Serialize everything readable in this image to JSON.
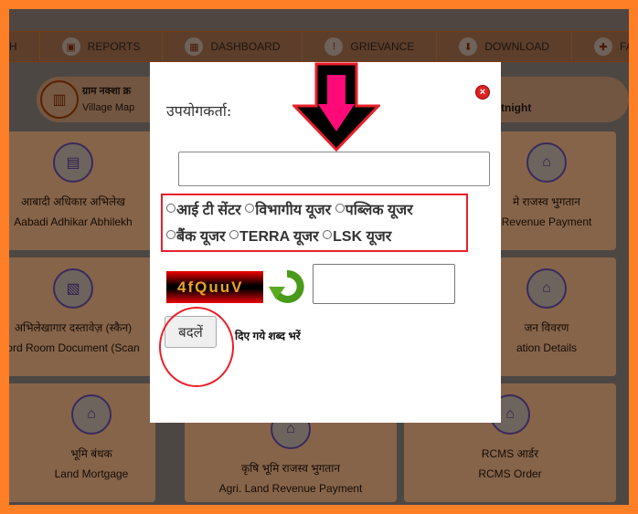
{
  "nav": {
    "items": [
      {
        "label": "H",
        "icon": "search-icon"
      },
      {
        "label": "REPORTS",
        "icon": "report-icon"
      },
      {
        "label": "DASHBOARD",
        "icon": "dashboard-icon"
      },
      {
        "label": "GRIEVANCE",
        "icon": "grievance-icon"
      },
      {
        "label": "DOWNLOAD",
        "icon": "download-icon"
      },
      {
        "label": "FAQ",
        "icon": "faq-icon"
      }
    ]
  },
  "banner": {
    "hindi": "ग्राम नक्शा क्र",
    "english": "Village Map",
    "right": "ortnight"
  },
  "cards": [
    {
      "hi": "आबादी अधिकार अभिलेख",
      "en": "Aabadi Adhikar Abhilekh"
    },
    {
      "hi": "मे राजस्व भुगतान",
      "en": "Revenue Payment"
    },
    {
      "hi": "अभिलेखागार दस्तावेज़ (स्कैन)",
      "en": "ord Room Document (Scan"
    },
    {
      "hi": "जन विवरण",
      "en": "ation Details"
    },
    {
      "hi": "भूमि बंधक",
      "en": "Land Mortgage"
    },
    {
      "hi": "कृषि भूमि राजस्व भुगतान",
      "en": "Agri. Land Revenue Payment"
    },
    {
      "hi": "RCMS आर्डर",
      "en": "RCMS Order"
    }
  ],
  "modal": {
    "user_label": "उपयोगकर्ता:",
    "user_value": "",
    "user_types": [
      "आई टी सेंटर",
      "विभागीय यूजर",
      "पब्लिक यूजर",
      "बैंक यूजर",
      "TERRA यूजर",
      "LSK यूजर"
    ],
    "captcha_text": "4fQuuV",
    "captcha_value": "",
    "change_button": "बदलें",
    "hint": "दिए गये शब्द भरें"
  },
  "colors": {
    "frame": "#ff7f27",
    "annotation": "#e8202a",
    "arrow": "#ff0a78"
  }
}
